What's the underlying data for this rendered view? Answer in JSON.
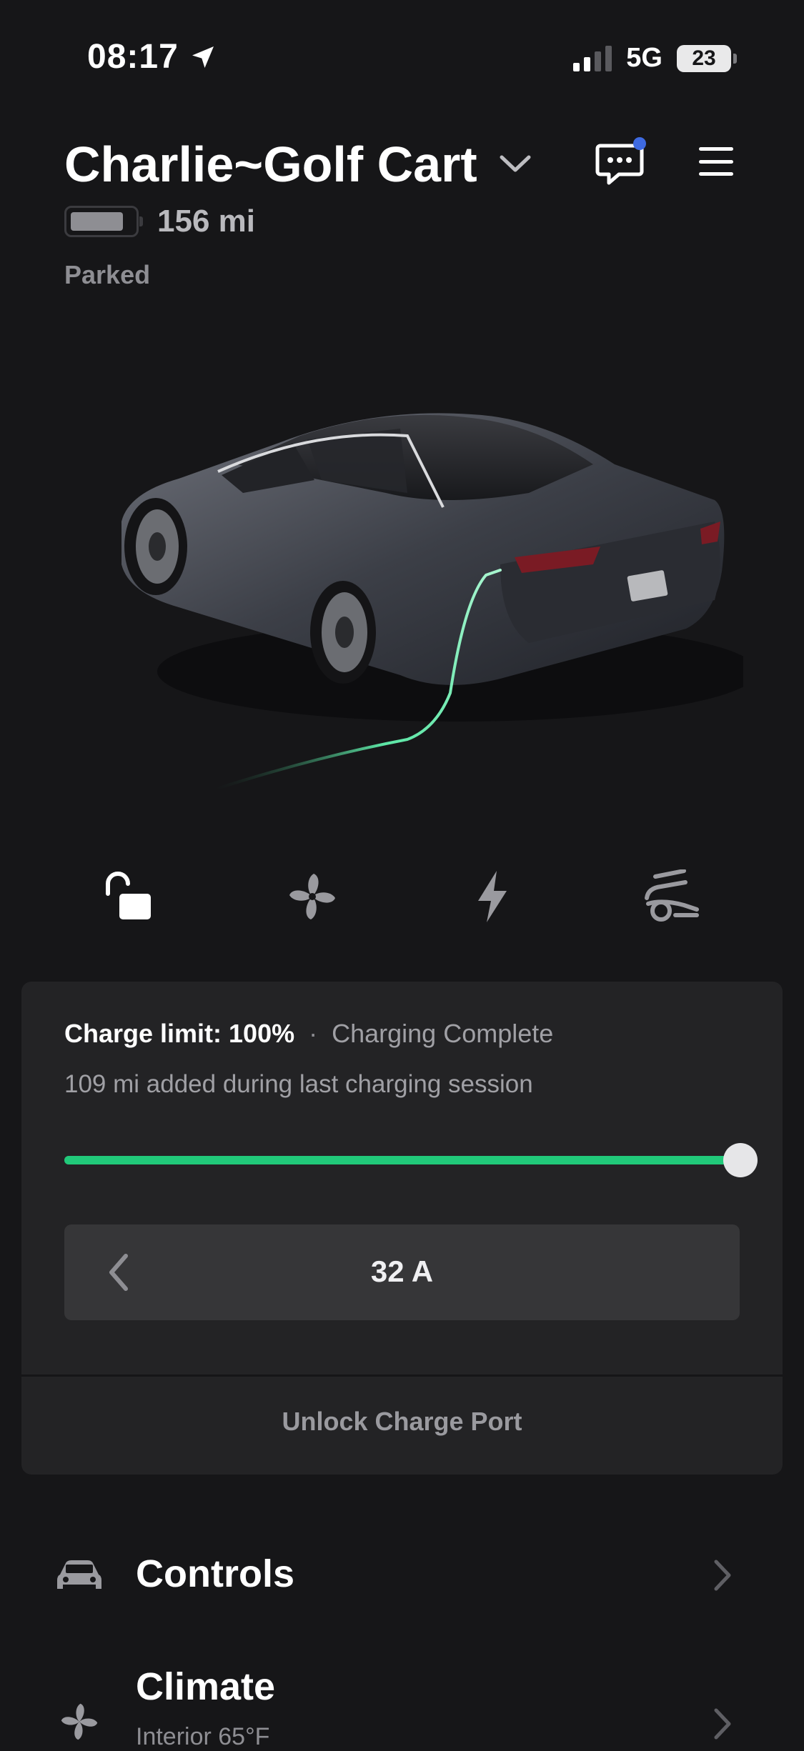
{
  "status_bar": {
    "time": "08:17",
    "network": "5G",
    "battery": "23",
    "location_icon": "location-arrow-icon"
  },
  "header": {
    "vehicle_name": "Charlie~Golf Cart",
    "range": "156 mi",
    "state": "Parked",
    "battery_level": 0.85,
    "message_icon": "chat-bubble-icon",
    "menu_icon": "hamburger-menu-icon",
    "unread_dot_color": "#3e6ae1"
  },
  "quick_actions": [
    {
      "name": "lock",
      "icon": "unlock-icon"
    },
    {
      "name": "climate",
      "icon": "fan-icon"
    },
    {
      "name": "charging",
      "icon": "lightning-icon"
    },
    {
      "name": "frunk",
      "icon": "car-front-trunk-icon"
    }
  ],
  "charging": {
    "limit_label": "Charge limit: 100%",
    "separator": "·",
    "status": "Charging Complete",
    "added": "109 mi added during last charging session",
    "limit_percent": 100,
    "accent_color": "#21c97a",
    "current": "32 A",
    "unlock_label": "Unlock Charge Port"
  },
  "menu": [
    {
      "label": "Controls",
      "subtitle": "",
      "icon": "car-icon"
    },
    {
      "label": "Climate",
      "subtitle": "Interior 65°F",
      "icon": "fan-icon"
    }
  ]
}
